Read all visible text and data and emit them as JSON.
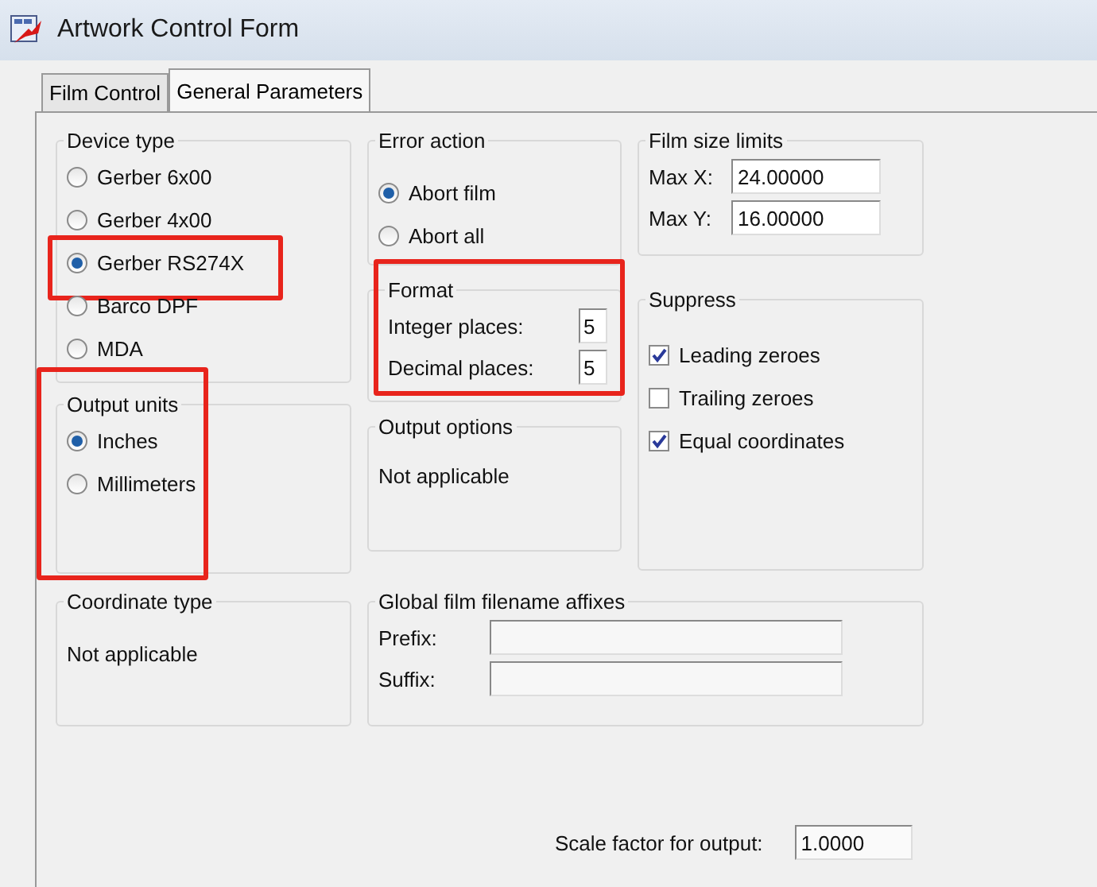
{
  "window": {
    "title": "Artwork Control Form"
  },
  "tabs": [
    {
      "label": "Film Control",
      "selected": false
    },
    {
      "label": "General Parameters",
      "selected": true
    }
  ],
  "columns": [
    [
      {
        "title": "Device type",
        "kind": "radio",
        "highlighted": false,
        "options": [
          {
            "label": "Gerber 6x00",
            "selected": false,
            "highlighted": false
          },
          {
            "label": "Gerber 4x00",
            "selected": false,
            "highlighted": false
          },
          {
            "label": "Gerber RS274X",
            "selected": true,
            "highlighted": true
          },
          {
            "label": "Barco DPF",
            "selected": false,
            "highlighted": false
          },
          {
            "label": "MDA",
            "selected": false,
            "highlighted": false
          }
        ]
      },
      {
        "title": "Output units",
        "kind": "radio",
        "highlighted": true,
        "options": [
          {
            "label": "Inches",
            "selected": true,
            "highlighted": false
          },
          {
            "label": "Millimeters",
            "selected": false,
            "highlighted": false
          }
        ]
      }
    ],
    [
      {
        "title": "Error action",
        "kind": "radio",
        "highlighted": false,
        "options": [
          {
            "label": "Abort film",
            "selected": true,
            "highlighted": false
          },
          {
            "label": "Abort all",
            "selected": false,
            "highlighted": false
          }
        ]
      },
      {
        "title": "Format",
        "kind": "fields",
        "highlighted": true,
        "fields": [
          {
            "label": "Integer places:",
            "value": "5"
          },
          {
            "label": "Decimal places:",
            "value": "5"
          }
        ]
      },
      {
        "title": "Output options",
        "kind": "text",
        "highlighted": false,
        "text": "Not applicable"
      }
    ],
    [
      {
        "title": "Film size limits",
        "kind": "fields",
        "highlighted": false,
        "fields": [
          {
            "label": "Max X:",
            "value": "24.00000"
          },
          {
            "label": "Max Y:",
            "value": "16.00000"
          }
        ]
      },
      {
        "title": "Suppress",
        "kind": "checkbox",
        "highlighted": false,
        "options": [
          {
            "label": "Leading zeroes",
            "checked": true
          },
          {
            "label": "Trailing zeroes",
            "checked": false
          },
          {
            "label": "Equal coordinates",
            "checked": true
          }
        ]
      }
    ]
  ],
  "bottom_row": [
    {
      "title": "Coordinate type",
      "kind": "text",
      "highlighted": false,
      "text": "Not applicable"
    },
    {
      "title": "Global film filename affixes",
      "kind": "fields",
      "highlighted": false,
      "fields": [
        {
          "label": "Prefix:"
        },
        {
          "label": "Suffix:"
        }
      ]
    }
  ],
  "scale_factor": {
    "label": "Scale factor for output:",
    "value": "1.0000"
  }
}
